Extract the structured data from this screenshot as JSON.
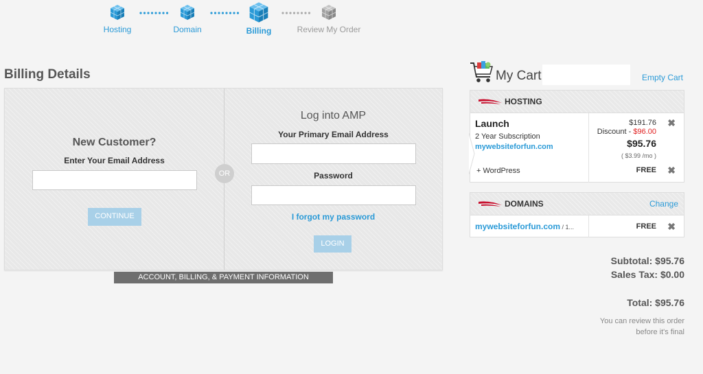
{
  "steps": [
    {
      "label": "Hosting",
      "state": "done"
    },
    {
      "label": "Domain",
      "state": "done"
    },
    {
      "label": "Billing",
      "state": "active"
    },
    {
      "label": "Review My Order",
      "state": "pending"
    }
  ],
  "billing": {
    "title": "Billing Details",
    "new_customer": {
      "heading": "New Customer?",
      "email_label": "Enter Your Email Address",
      "email_value": "",
      "continue_label": "CONTINUE"
    },
    "or_label": "OR",
    "login": {
      "heading": "Log into AMP",
      "email_label": "Your Primary Email Address",
      "email_value": "",
      "password_label": "Password",
      "password_value": "",
      "forgot_label": "I forgot my password",
      "login_label": "LOGIN"
    },
    "banner": "ACCOUNT, BILLING, & PAYMENT INFORMATION"
  },
  "cart": {
    "title": "My Cart",
    "empty_label": "Empty Cart",
    "hosting": {
      "header": "HOSTING",
      "plan": "Launch",
      "term": "2 Year Subscription",
      "domain": "mywebsiteforfun.com",
      "price": "$191.76",
      "discount_label": "Discount - ",
      "discount_value": "$96.00",
      "total": "$95.76",
      "monthly": "( $3.99 /mo )",
      "addon": "+ WordPress",
      "addon_price": "FREE"
    },
    "domains": {
      "header": "DOMAINS",
      "change_label": "Change",
      "domain": "mywebsiteforfun.com",
      "domain_suffix": " / 1...",
      "price": "FREE"
    },
    "subtotal": "Subtotal: $95.76",
    "sales_tax": "Sales Tax: $0.00",
    "total": "Total: $95.76",
    "note_line1": "You can review this order",
    "note_line2": "before it's final"
  },
  "colors": {
    "accent_blue": "#2a9ad7",
    "button_blue": "#a8d0e8",
    "discount_red": "#e02020",
    "swoosh_red": "#c8102e"
  }
}
